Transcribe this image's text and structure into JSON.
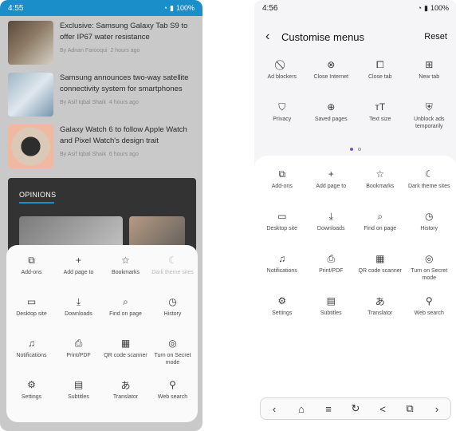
{
  "left": {
    "status": {
      "time": "4:55",
      "battery": "100%"
    },
    "news": [
      {
        "title": "Exclusive: Samsung Galaxy Tab S9 to offer IP67 water resistance",
        "author": "By Adnan Farooqui",
        "age": "2 hours ago"
      },
      {
        "title": "Samsung announces two-way satellite connectivity system for smartphones",
        "author": "By Asif Iqbal Shaik",
        "age": "4 hours ago"
      },
      {
        "title": "Galaxy Watch 6 to follow Apple Watch and Pixel Watch's design trait",
        "author": "By Asif Iqbal Shaik",
        "age": "6 hours ago"
      }
    ],
    "opinions_label": "OPINIONS",
    "menu": [
      {
        "label": "Add-ons",
        "icon": "addons-icon",
        "glyph": "⧉"
      },
      {
        "label": "Add page to",
        "icon": "plus-icon",
        "glyph": "+"
      },
      {
        "label": "Bookmarks",
        "icon": "star-icon",
        "glyph": "☆"
      },
      {
        "label": "Dark theme sites",
        "icon": "moon-icon",
        "glyph": "☾",
        "dim": true
      },
      {
        "label": "Desktop site",
        "icon": "monitor-icon",
        "glyph": "▭"
      },
      {
        "label": "Downloads",
        "icon": "download-icon",
        "glyph": "⤓"
      },
      {
        "label": "Find on page",
        "icon": "find-icon",
        "glyph": "⌕"
      },
      {
        "label": "History",
        "icon": "clock-icon",
        "glyph": "◷"
      },
      {
        "label": "Notifications",
        "icon": "bell-icon",
        "glyph": "♫"
      },
      {
        "label": "Print/PDF",
        "icon": "print-icon",
        "glyph": "⎙"
      },
      {
        "label": "QR code scanner",
        "icon": "qr-icon",
        "glyph": "▦"
      },
      {
        "label": "Turn on Secret mode",
        "icon": "secret-mode-icon",
        "glyph": "◎"
      },
      {
        "label": "Settings",
        "icon": "gear-icon",
        "glyph": "⚙"
      },
      {
        "label": "Subtitles",
        "icon": "subtitles-icon",
        "glyph": "▤"
      },
      {
        "label": "Translator",
        "icon": "translate-icon",
        "glyph": "あ"
      },
      {
        "label": "Web search",
        "icon": "search-icon",
        "glyph": "⚲"
      }
    ]
  },
  "right": {
    "status": {
      "time": "4:56",
      "battery": "100%"
    },
    "title": "Customise menus",
    "reset": "Reset",
    "top": [
      {
        "label": "Ad blockers",
        "icon": "adblock-icon",
        "glyph": "⃠"
      },
      {
        "label": "Close Internet",
        "icon": "close-circle-icon",
        "glyph": "⊗"
      },
      {
        "label": "Close tab",
        "icon": "close-tab-icon",
        "glyph": "⧠"
      },
      {
        "label": "New tab",
        "icon": "new-tab-icon",
        "glyph": "⊞"
      },
      {
        "label": "Privacy",
        "icon": "shield-icon",
        "glyph": "⛉"
      },
      {
        "label": "Saved pages",
        "icon": "globe-icon",
        "glyph": "⊕"
      },
      {
        "label": "Text size",
        "icon": "text-size-icon",
        "glyph": "ᴛT"
      },
      {
        "label": "Unblock ads temporarily",
        "icon": "unblock-icon",
        "glyph": "⛨"
      }
    ],
    "menu": [
      {
        "label": "Add-ons",
        "icon": "addons-icon",
        "glyph": "⧉"
      },
      {
        "label": "Add page to",
        "icon": "plus-icon",
        "glyph": "+"
      },
      {
        "label": "Bookmarks",
        "icon": "star-icon",
        "glyph": "☆"
      },
      {
        "label": "Dark theme sites",
        "icon": "moon-icon",
        "glyph": "☾"
      },
      {
        "label": "Desktop site",
        "icon": "monitor-icon",
        "glyph": "▭"
      },
      {
        "label": "Downloads",
        "icon": "download-icon",
        "glyph": "⤓"
      },
      {
        "label": "Find on page",
        "icon": "find-icon",
        "glyph": "⌕"
      },
      {
        "label": "History",
        "icon": "clock-icon",
        "glyph": "◷"
      },
      {
        "label": "Notifications",
        "icon": "bell-icon",
        "glyph": "♫"
      },
      {
        "label": "Print/PDF",
        "icon": "print-icon",
        "glyph": "⎙"
      },
      {
        "label": "QR code scanner",
        "icon": "qr-icon",
        "glyph": "▦"
      },
      {
        "label": "Turn on Secret mode",
        "icon": "secret-mode-icon",
        "glyph": "◎"
      },
      {
        "label": "Settings",
        "icon": "gear-icon",
        "glyph": "⚙"
      },
      {
        "label": "Subtitles",
        "icon": "subtitles-icon",
        "glyph": "▤"
      },
      {
        "label": "Translator",
        "icon": "translate-icon",
        "glyph": "あ"
      },
      {
        "label": "Web search",
        "icon": "search-icon",
        "glyph": "⚲"
      }
    ],
    "bottom_bar": [
      {
        "icon": "back-icon",
        "glyph": "‹"
      },
      {
        "icon": "home-icon",
        "glyph": "⌂"
      },
      {
        "icon": "menu-icon",
        "glyph": "≡"
      },
      {
        "icon": "refresh-icon",
        "glyph": "↻"
      },
      {
        "icon": "share-icon",
        "glyph": "<"
      },
      {
        "icon": "tabs-icon",
        "glyph": "⧉"
      },
      {
        "icon": "forward-icon",
        "glyph": "›"
      }
    ]
  },
  "colors": {
    "accent": "#1a8ec9",
    "purple_dot": "#7b4fd6"
  }
}
